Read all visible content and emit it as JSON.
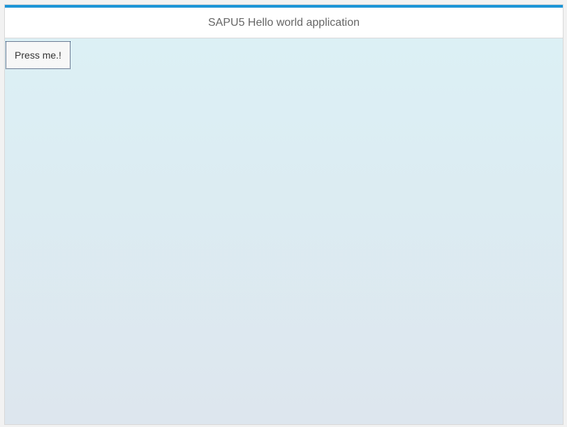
{
  "header": {
    "title": "SAPU5 Hello world application"
  },
  "main": {
    "button_label": "Press me.!"
  },
  "colors": {
    "accent": "#1d95d7",
    "content_top": "#dcf0f5",
    "content_bottom": "#dde6ee"
  }
}
